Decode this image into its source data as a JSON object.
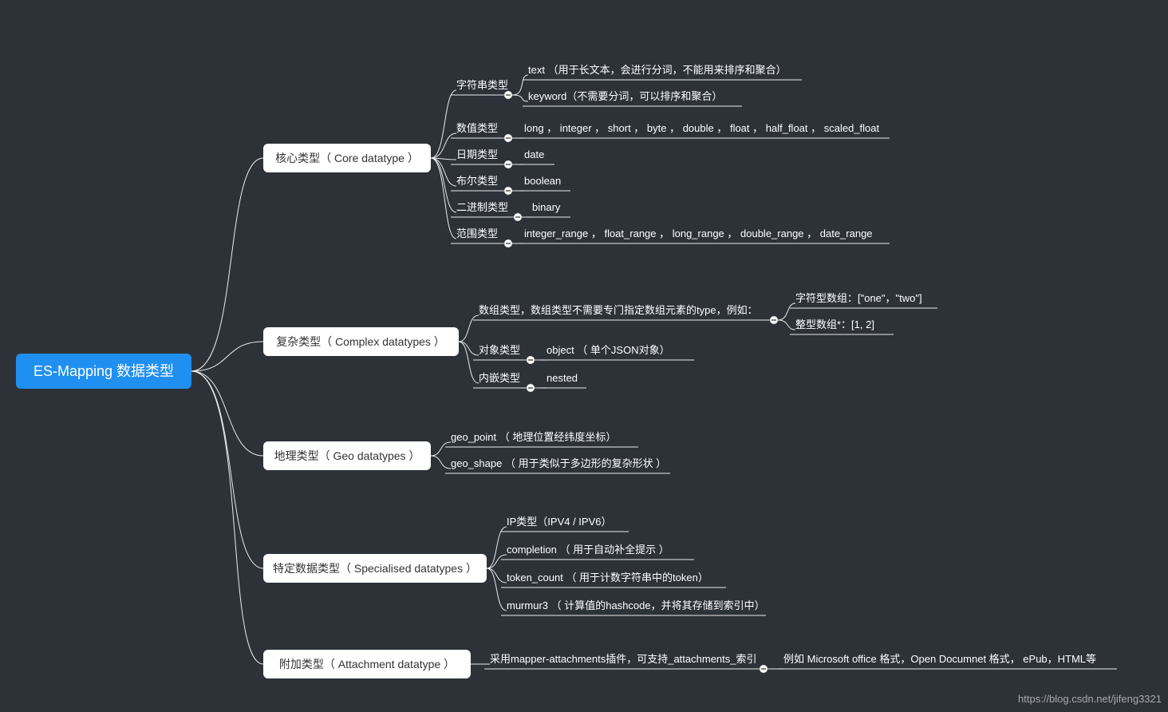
{
  "root": "ES-Mapping 数据类型",
  "watermark": "https://blog.csdn.net/jifeng3321",
  "branches": {
    "core": {
      "label": "核心类型（ Core datatype ）"
    },
    "complex": {
      "label": "复杂类型（ Complex datatypes ）"
    },
    "geo": {
      "label": "地理类型（ Geo datatypes ）"
    },
    "specialised": {
      "label": "特定数据类型（ Specialised datatypes ）"
    },
    "attachment": {
      "label": "附加类型（ Attachment datatype ）"
    }
  },
  "core": {
    "string_label": "字符串类型",
    "string_text": "text （用于长文本，会进行分词，不能用来排序和聚合）",
    "string_keyword": "keyword（不需要分词，可以排序和聚合）",
    "numeric_label": "数值类型",
    "numeric_value": "long ， integer ， short ， byte ， double ， float ， half_float ， scaled_float",
    "date_label": "日期类型",
    "date_value": "date",
    "boolean_label": "布尔类型",
    "boolean_value": "boolean",
    "binary_label": "二进制类型",
    "binary_value": "binary",
    "range_label": "范围类型",
    "range_value": "integer_range ， float_range ， long_range ， double_range ， date_range"
  },
  "complex": {
    "array_label": "数组类型，数组类型不需要专门指定数组元素的type，例如：",
    "array_string": "字符型数组：[\"one\"，\"two\"]",
    "array_int": "整型数组*：[1, 2]",
    "object_label": "对象类型",
    "object_value": "object （ 单个JSON对象）",
    "nested_label": "内嵌类型",
    "nested_value": "nested"
  },
  "geo": {
    "geo_point": "geo_point （ 地理位置经纬度坐标）",
    "geo_shape": "geo_shape （ 用于类似于多边形的复杂形状 ）"
  },
  "specialised": {
    "ip": "IP类型（IPV4 / IPV6）",
    "completion": "completion （ 用于自动补全提示 ）",
    "token_count": "token_count （ 用于计数字符串中的token）",
    "murmur3": "murmur3 （ 计算值的hashcode，并将其存储到索引中）"
  },
  "attachment": {
    "plugin": "采用mapper-attachments插件，可支持_attachments_索引",
    "example": "例如 Microsoft office 格式，Open Documnet 格式， ePub，HTML等"
  }
}
